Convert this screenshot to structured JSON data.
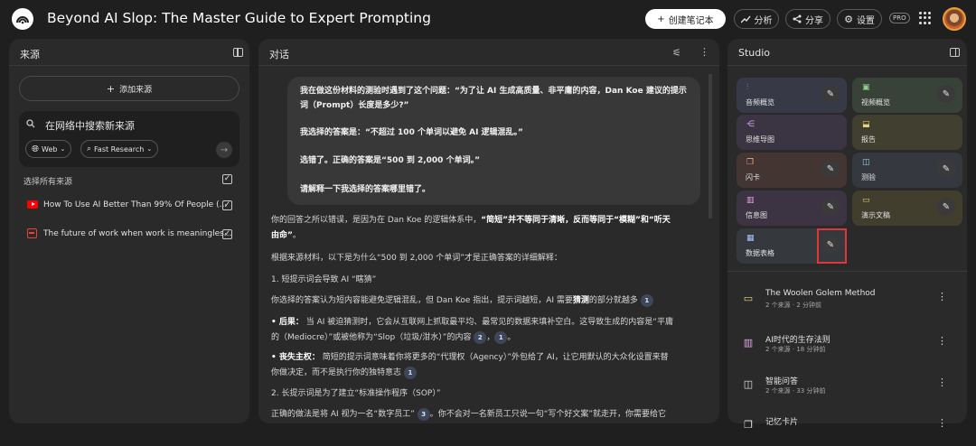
{
  "header": {
    "title": "Beyond AI Slop: The Master Guide to Expert Prompting",
    "create_label": "创建笔记本",
    "analyze_label": "分析",
    "share_label": "分享",
    "settings_label": "设置",
    "pro_badge": "PRO"
  },
  "sources": {
    "title": "来源",
    "add_label": "添加来源",
    "search_placeholder": "在网络中搜索新来源",
    "web_chip": "Web",
    "research_chip": "Fast Research",
    "select_all": "选择所有来源",
    "items": [
      {
        "title": "How To Use AI Better Than 99% Of People (...",
        "icon": "youtube-icon",
        "color": "#ff0000"
      },
      {
        "title": "The future of work when work is meaningles...",
        "icon": "document-icon",
        "color": "#ea4335"
      }
    ]
  },
  "chat": {
    "title": "对话",
    "question": [
      "我在做这份材料的测验时遇到了这个问题：“为了让 AI 生成高质量、非平庸的内容，Dan Koe 建议的提示",
      "词（Prompt）长度是多少?”",
      "我选择的答案是：“不超过 100 个单词以避免 AI 逻辑混乱。”",
      "选错了。正确的答案是“500 到 2,000 个单词。”",
      "请解释一下我选择的答案哪里错了。"
    ],
    "answer": {
      "p1a": "你的回答之所以错误，是因为在 Dan Koe 的逻辑体系中，",
      "p1b": "“简短”并不等同于清晰，反而等同于“模糊”和“听天",
      "p1c": "由命”",
      "p1d": "。",
      "p2": "根据来源材料，以下是为什么“500 到 2,000 个单词”才是正确答案的详细解释：",
      "h1": "1. 短提示词会导致 AI “瞎猜”",
      "p3a": "你选择的答案认为短内容能避免逻辑混乱，但 Dan Koe 指出，提示词越短，AI 需要",
      "p3b": "猜测",
      "p3c": "的部分就越多",
      "b1_label": "• 后果：",
      "b1a": "当 AI 被迫猜测时，它会从互联网上抓取最平均、最常见的数据来填补空白。这导致生成的内容是“平庸",
      "b1b": "的（Mediocre）”或被他称为“Slop（垃圾/泔水）”的内容",
      "b2_label": "• 丧失主权：",
      "b2a": "简短的提示词意味着你将更多的“代理权（Agency）”外包给了 AI，让它用默认的大众化设置来替",
      "b2b": "你做决定，而不是执行你的独特意志",
      "h2": "2. 长提示词是为了建立“标准操作程序（SOP）”",
      "p4": "正确的做法是将 AI 视为一名“数字员工”",
      "p4b": "。你不会对一名新员工只说一句“写个好文案”就走开，你需要给它",
      "cites": [
        "1",
        "2",
        "1",
        "1",
        "3"
      ]
    }
  },
  "studio": {
    "title": "Studio",
    "cards": [
      {
        "label": "音频概览",
        "icon": "audio-icon",
        "bg": "#373a46",
        "accent": "#a8b4ff"
      },
      {
        "label": "视频概览",
        "icon": "video-icon",
        "bg": "#384238",
        "accent": "#8fd18f"
      },
      {
        "label": "思维导图",
        "icon": "mindmap-icon",
        "bg": "#3b3442",
        "accent": "#d8a4f0"
      },
      {
        "label": "报告",
        "icon": "report-icon",
        "bg": "#413f2f",
        "accent": "#e6d27a"
      },
      {
        "label": "闪卡",
        "icon": "flashcard-icon",
        "bg": "#433632",
        "accent": "#f0a98a"
      },
      {
        "label": "测验",
        "icon": "quiz-icon",
        "bg": "#35393f",
        "accent": "#9fd0ea"
      },
      {
        "label": "信息图",
        "icon": "infographic-icon",
        "bg": "#3d3443",
        "accent": "#e6a2e6"
      },
      {
        "label": "演示文稿",
        "icon": "slides-icon",
        "bg": "#413e2e",
        "accent": "#e6d27a"
      },
      {
        "label": "数据表格",
        "icon": "table-icon",
        "bg": "#35383d",
        "accent": "#a8c4ff"
      }
    ],
    "notes": [
      {
        "title": "The Woolen Golem Method",
        "sub": "2 个来源 · 2 分钟前",
        "icon": "slides-icon"
      },
      {
        "title": "AI时代的生存法则",
        "sub": "2 个来源 · 18 分钟前",
        "icon": "infographic-icon"
      },
      {
        "title": "智能问答",
        "sub": "2 个来源 · 33 分钟前",
        "icon": "quiz-icon"
      },
      {
        "title": "记忆卡片",
        "sub": "",
        "icon": "flashcard-icon"
      }
    ]
  }
}
